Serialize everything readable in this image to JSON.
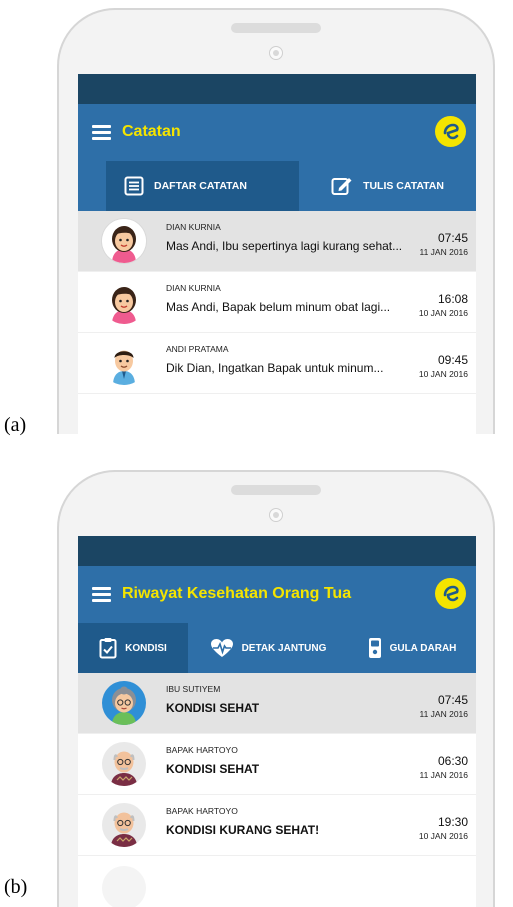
{
  "figure_labels": {
    "a": "(a)",
    "b": "(b)"
  },
  "panel_a": {
    "title": "Catatan",
    "logo_icon": "app-logo-e",
    "tabs": [
      {
        "label": "DAFTAR CATATAN",
        "icon": "list-icon",
        "active": true
      },
      {
        "label": "TULIS CATATAN",
        "icon": "edit-icon",
        "active": false
      }
    ],
    "rows": [
      {
        "sender": "DIAN KURNIA",
        "message": "Mas Andi, Ibu sepertinya lagi kurang sehat...",
        "time": "07:45",
        "date": "11 JAN 2016",
        "avatar": "woman-avatar",
        "selected": true
      },
      {
        "sender": "DIAN KURNIA",
        "message": "Mas Andi, Bapak belum minum obat lagi...",
        "time": "16:08",
        "date": "10 JAN 2016",
        "avatar": "woman-avatar",
        "selected": false
      },
      {
        "sender": "ANDI PRATAMA",
        "message": "Dik Dian, Ingatkan Bapak untuk minum...",
        "time": "09:45",
        "date": "10 JAN 2016",
        "avatar": "man-avatar",
        "selected": false
      }
    ]
  },
  "panel_b": {
    "title": "Riwayat Kesehatan Orang Tua",
    "logo_icon": "app-logo-e",
    "tabs": [
      {
        "label": "KONDISI",
        "icon": "clipboard-icon",
        "active": true
      },
      {
        "label": "DETAK JANTUNG",
        "icon": "heartbeat-icon",
        "active": false
      },
      {
        "label": "GULA DARAH",
        "icon": "glucose-meter-icon",
        "active": false
      }
    ],
    "rows": [
      {
        "sender": "IBU SUTIYEM",
        "message": "KONDISI SEHAT",
        "time": "07:45",
        "date": "11 JAN 2016",
        "avatar": "grandmother-avatar",
        "selected": true
      },
      {
        "sender": "BAPAK HARTOYO",
        "message": "KONDISI SEHAT",
        "time": "06:30",
        "date": "11 JAN 2016",
        "avatar": "grandfather-avatar",
        "selected": false
      },
      {
        "sender": "BAPAK HARTOYO",
        "message": "KONDISI KURANG SEHAT!",
        "time": "19:30",
        "date": "10 JAN 2016",
        "avatar": "grandfather-avatar",
        "selected": false
      }
    ]
  },
  "colors": {
    "status_bar": "#1b4563",
    "app_bar": "#2e6fa8",
    "active_tab": "#1f5a8b",
    "title_yellow": "#f4e400",
    "selected_row": "#e3e3e3"
  }
}
